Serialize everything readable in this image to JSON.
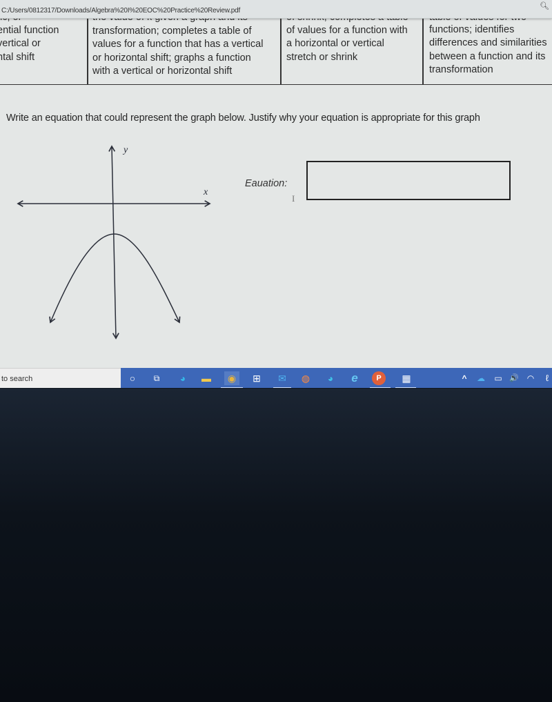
{
  "browser": {
    "url": "C:/Users/0812317/Downloads/Algebra%20I%20EOC%20Practice%20Review.pdf",
    "zoom_icon": "zoom-in-icon"
  },
  "rubric_table": {
    "columns": [
      {
        "lines": [
          "tic, or",
          "ential function",
          "vertical or",
          "ntal shift"
        ]
      },
      {
        "lines": [
          "the value of k given a graph and its",
          "transformation;  completes a table of",
          "values for a function that has a vertical",
          "or horizontal shift; graphs a function",
          "with a vertical or horizontal shift"
        ]
      },
      {
        "lines": [
          "of shrink; completes a table",
          "of values for a function with",
          "a horizontal or vertical",
          "stretch or shrink"
        ]
      },
      {
        "lines": [
          "table of values for two",
          "functions; identifies",
          "differences and similarities",
          "between a function and its",
          "transformation"
        ]
      }
    ]
  },
  "question": {
    "prompt": "Write an equation that could represent the graph below. Justify why your equation is appropriate for this graph",
    "equation_label": "Eauation:",
    "equation_value": "",
    "cursor_glyph": "I"
  },
  "graph": {
    "x_label": "x",
    "y_label": "y",
    "curve": "downward-opening parabola",
    "vertex": "on y-axis, below x-axis"
  },
  "taskbar": {
    "search_placeholder": "to search",
    "icons": [
      {
        "name": "cortana-icon",
        "glyph": "○",
        "color": "#ffffff"
      },
      {
        "name": "task-view-icon",
        "glyph": "⧉",
        "color": "#ffffff"
      },
      {
        "name": "edge-icon",
        "glyph": "◕",
        "color": "#35b6e8"
      },
      {
        "name": "file-explorer-icon",
        "glyph": "▬",
        "color": "#f2c94c"
      },
      {
        "name": "chrome-icon",
        "glyph": "◉",
        "color": "#e9b53c"
      },
      {
        "name": "store-icon",
        "glyph": "⊞",
        "color": "#ffffff"
      },
      {
        "name": "mail-icon",
        "glyph": "✉",
        "color": "#4fb3f0"
      },
      {
        "name": "firefox-icon",
        "glyph": "◍",
        "color": "#ff8b3d"
      },
      {
        "name": "edge-new-icon",
        "glyph": "◕",
        "color": "#3fc1e6"
      },
      {
        "name": "internet-explorer-icon",
        "glyph": "e",
        "color": "#65c6f2"
      },
      {
        "name": "powerpoint-icon",
        "glyph": "P",
        "color": "#e0603a"
      },
      {
        "name": "calculator-icon",
        "glyph": "▦",
        "color": "#ffffff"
      }
    ],
    "tray": [
      {
        "name": "chevron-up-icon",
        "glyph": "^"
      },
      {
        "name": "onedrive-icon",
        "glyph": "☁"
      },
      {
        "name": "battery-icon",
        "glyph": "▭"
      },
      {
        "name": "volume-icon",
        "glyph": "🔊"
      },
      {
        "name": "wifi-icon",
        "glyph": "◠"
      },
      {
        "name": "pen-icon",
        "glyph": "ℓ"
      }
    ]
  }
}
